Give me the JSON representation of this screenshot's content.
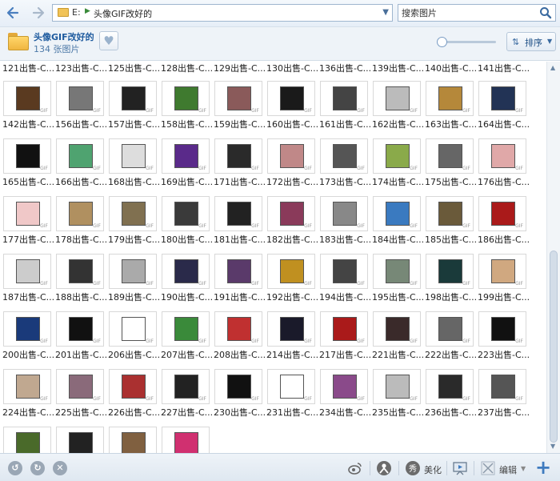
{
  "address": {
    "drive": "E:",
    "path": "头像GIF改好的"
  },
  "search": {
    "placeholder": "搜索图片"
  },
  "folder": {
    "name": "头像GIF改好的",
    "count": "134 张图片"
  },
  "sort": {
    "label": "排序"
  },
  "gif_tag": "GIF",
  "top_captions": [
    "121出售-C...",
    "123出售-C...",
    "125出售-C...",
    "128出售-C...",
    "129出售-C...",
    "130出售-C...",
    "136出售-C...",
    "139出售-C...",
    "140出售-C...",
    "141出售-C..."
  ],
  "rows": [
    {
      "captions": [
        "142出售-C...",
        "156出售-C...",
        "157出售-C...",
        "158出售-C...",
        "159出售-C...",
        "160出售-C...",
        "161出售-C...",
        "162出售-C...",
        "163出售-C...",
        "164出售-C..."
      ],
      "colors": [
        "#5a3a20",
        "#777777",
        "#222222",
        "#3f7a2f",
        "#8a5a5a",
        "#1a1a1a",
        "#444444",
        "#bbbbbb",
        "#b5883a",
        "#223355"
      ]
    },
    {
      "captions": [
        "165出售-C...",
        "166出售-C...",
        "168出售-C...",
        "169出售-C...",
        "171出售-C...",
        "172出售-C...",
        "173出售-C...",
        "174出售-C...",
        "175出售-C...",
        "176出售-C..."
      ],
      "colors": [
        "#111111",
        "#4fa370",
        "#dddddd",
        "#5a2a8a",
        "#2a2a2a",
        "#c08888",
        "#555555",
        "#8aaa4a",
        "#666666",
        "#e0a8a8"
      ]
    },
    {
      "captions": [
        "177出售-C...",
        "178出售-C...",
        "179出售-C...",
        "180出售-C...",
        "181出售-C...",
        "182出售-C...",
        "183出售-C...",
        "184出售-C...",
        "185出售-C...",
        "186出售-C..."
      ],
      "colors": [
        "#f0c8c8",
        "#b09060",
        "#807050",
        "#3a3a3a",
        "#222222",
        "#8a3a5a",
        "#888888",
        "#3a7ac0",
        "#6a5a3a",
        "#aa1a1a"
      ]
    },
    {
      "captions": [
        "187出售-C...",
        "188出售-C...",
        "189出售-C...",
        "190出售-C...",
        "191出售-C...",
        "192出售-C...",
        "194出售-C...",
        "195出售-C...",
        "198出售-C...",
        "199出售-C..."
      ],
      "colors": [
        "#cccccc",
        "#333333",
        "#aaaaaa",
        "#2a2a4a",
        "#5a3a6a",
        "#c09020",
        "#444444",
        "#778877",
        "#1a3a3a",
        "#d0a880"
      ]
    },
    {
      "captions": [
        "200出售-C...",
        "201出售-C...",
        "206出售-C...",
        "207出售-C...",
        "208出售-C...",
        "214出售-C...",
        "217出售-C...",
        "221出售-C...",
        "222出售-C...",
        "223出售-C..."
      ],
      "colors": [
        "#1a3a7a",
        "#111111",
        "#ffffff",
        "#3a8a3a",
        "#c03030",
        "#1a1a2a",
        "#aa1a1a",
        "#3a2a2a",
        "#666666",
        "#111111"
      ]
    },
    {
      "captions": [
        "224出售-C...",
        "225出售-C...",
        "226出售-C...",
        "227出售-C...",
        "230出售-C...",
        "231出售-C...",
        "234出售-C...",
        "235出售-C...",
        "236出售-C...",
        "237出售-C..."
      ],
      "colors": [
        "#c0a890",
        "#8a6a7a",
        "#aa3030",
        "#222222",
        "#111111",
        "#ffffff",
        "#8a4a8a",
        "#bbbbbb",
        "#2a2a2a",
        "#555555"
      ]
    },
    {
      "captions": [
        "",
        "",
        "",
        ""
      ],
      "colors": [
        "#4a6a2a",
        "#222222",
        "#806040",
        "#d03070"
      ]
    }
  ],
  "bottom": {
    "beautify_label": "美化",
    "edit_label": "编辑"
  },
  "colors": {
    "accent": "#3f7bbf",
    "link": "#1d5a9e"
  }
}
